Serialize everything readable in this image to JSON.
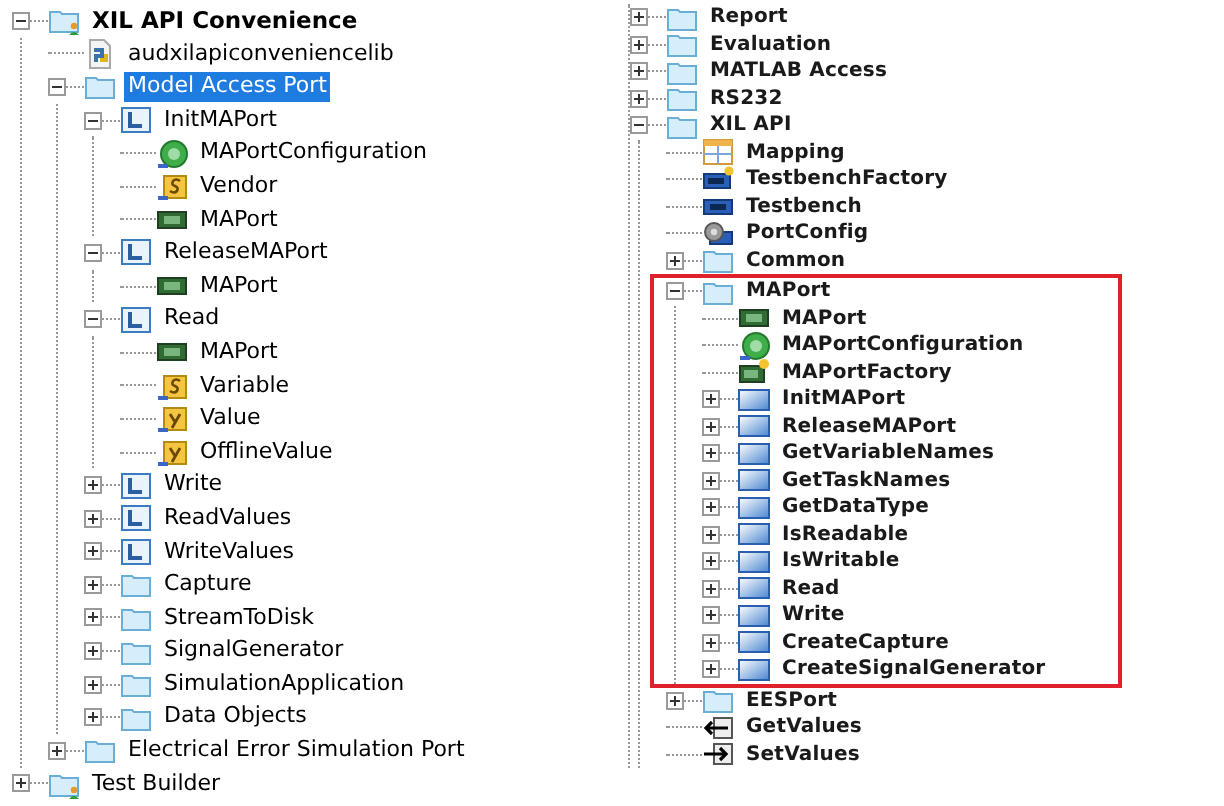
{
  "left_tree": [
    {
      "label": "XIL API Convenience",
      "kind": "folder-user",
      "bold": true,
      "expanded": true,
      "selected": false,
      "children": [
        {
          "label": "audxilapiconveniencelib",
          "kind": "python",
          "selected": false
        },
        {
          "label": "Model Access Port",
          "kind": "folder",
          "expanded": true,
          "selected": true,
          "children": [
            {
              "label": "InitMAPort",
              "kind": "library",
              "expanded": true,
              "selected": false,
              "children": [
                {
                  "label": "MAPortConfiguration",
                  "kind": "config",
                  "selected": false
                },
                {
                  "label": "Vendor",
                  "kind": "string",
                  "selected": false
                },
                {
                  "label": "MAPort",
                  "kind": "port",
                  "selected": false
                }
              ]
            },
            {
              "label": "ReleaseMAPort",
              "kind": "library",
              "expanded": true,
              "selected": false,
              "children": [
                {
                  "label": "MAPort",
                  "kind": "port",
                  "selected": false
                }
              ]
            },
            {
              "label": "Read",
              "kind": "library",
              "expanded": true,
              "selected": false,
              "children": [
                {
                  "label": "MAPort",
                  "kind": "port",
                  "selected": false
                },
                {
                  "label": "Variable",
                  "kind": "string",
                  "selected": false
                },
                {
                  "label": "Value",
                  "kind": "value",
                  "selected": false
                },
                {
                  "label": "OfflineValue",
                  "kind": "value",
                  "selected": false
                }
              ]
            },
            {
              "label": "Write",
              "kind": "library",
              "expanded": false,
              "selected": false
            },
            {
              "label": "ReadValues",
              "kind": "library",
              "expanded": false,
              "selected": false
            },
            {
              "label": "WriteValues",
              "kind": "library",
              "expanded": false,
              "selected": false
            },
            {
              "label": "Capture",
              "kind": "folder",
              "expanded": false,
              "selected": false
            },
            {
              "label": "StreamToDisk",
              "kind": "folder",
              "expanded": false,
              "selected": false
            },
            {
              "label": "SignalGenerator",
              "kind": "folder",
              "expanded": false,
              "selected": false
            },
            {
              "label": "SimulationApplication",
              "kind": "folder",
              "expanded": false,
              "selected": false
            },
            {
              "label": "Data Objects",
              "kind": "folder",
              "expanded": false,
              "selected": false
            }
          ]
        },
        {
          "label": "Electrical Error Simulation Port",
          "kind": "folder",
          "expanded": false,
          "selected": false
        }
      ]
    },
    {
      "label": "Test Builder",
      "kind": "folder-user",
      "expanded": false,
      "selected": false
    }
  ],
  "right_tree": [
    {
      "label": "Report",
      "kind": "folder",
      "expanded": false,
      "selected": false
    },
    {
      "label": "Evaluation",
      "kind": "folder",
      "expanded": false,
      "selected": false
    },
    {
      "label": "MATLAB Access",
      "kind": "folder",
      "expanded": false,
      "selected": false
    },
    {
      "label": "RS232",
      "kind": "folder",
      "expanded": false,
      "selected": false
    },
    {
      "label": "XIL API",
      "kind": "folder",
      "expanded": true,
      "selected": false,
      "children": [
        {
          "label": "Mapping",
          "kind": "table",
          "selected": false,
          "highlighted": false
        },
        {
          "label": "TestbenchFactory",
          "kind": "bench-star",
          "selected": false,
          "highlighted": false
        },
        {
          "label": "Testbench",
          "kind": "bench",
          "selected": false,
          "highlighted": false
        },
        {
          "label": "PortConfig",
          "kind": "gear-card",
          "selected": false,
          "highlighted": false
        },
        {
          "label": "Common",
          "kind": "folder",
          "expanded": false,
          "selected": false,
          "highlighted": false
        },
        {
          "label": "MAPort",
          "kind": "folder",
          "expanded": true,
          "selected": false,
          "highlighted": true,
          "children": [
            {
              "label": "MAPort",
              "kind": "port",
              "selected": false
            },
            {
              "label": "MAPortConfiguration",
              "kind": "config",
              "selected": false
            },
            {
              "label": "MAPortFactory",
              "kind": "port-star",
              "selected": false
            },
            {
              "label": "InitMAPort",
              "kind": "method",
              "expanded": false,
              "selected": false
            },
            {
              "label": "ReleaseMAPort",
              "kind": "method",
              "expanded": false,
              "selected": false
            },
            {
              "label": "GetVariableNames",
              "kind": "method",
              "expanded": false,
              "selected": false
            },
            {
              "label": "GetTaskNames",
              "kind": "method",
              "expanded": false,
              "selected": false
            },
            {
              "label": "GetDataType",
              "kind": "method",
              "expanded": false,
              "selected": false
            },
            {
              "label": "IsReadable",
              "kind": "method",
              "expanded": false,
              "selected": false
            },
            {
              "label": "IsWritable",
              "kind": "method",
              "expanded": false,
              "selected": false
            },
            {
              "label": "Read",
              "kind": "method",
              "expanded": false,
              "selected": false
            },
            {
              "label": "Write",
              "kind": "method",
              "expanded": false,
              "selected": false
            },
            {
              "label": "CreateCapture",
              "kind": "method",
              "expanded": false,
              "selected": false
            },
            {
              "label": "CreateSignalGenerator",
              "kind": "method",
              "expanded": false,
              "selected": false
            }
          ]
        },
        {
          "label": "EESPort",
          "kind": "folder",
          "expanded": false,
          "selected": false,
          "highlighted": false
        },
        {
          "label": "GetValues",
          "kind": "get",
          "selected": false,
          "highlighted": false
        },
        {
          "label": "SetValues",
          "kind": "set",
          "selected": false,
          "highlighted": false
        }
      ]
    }
  ]
}
